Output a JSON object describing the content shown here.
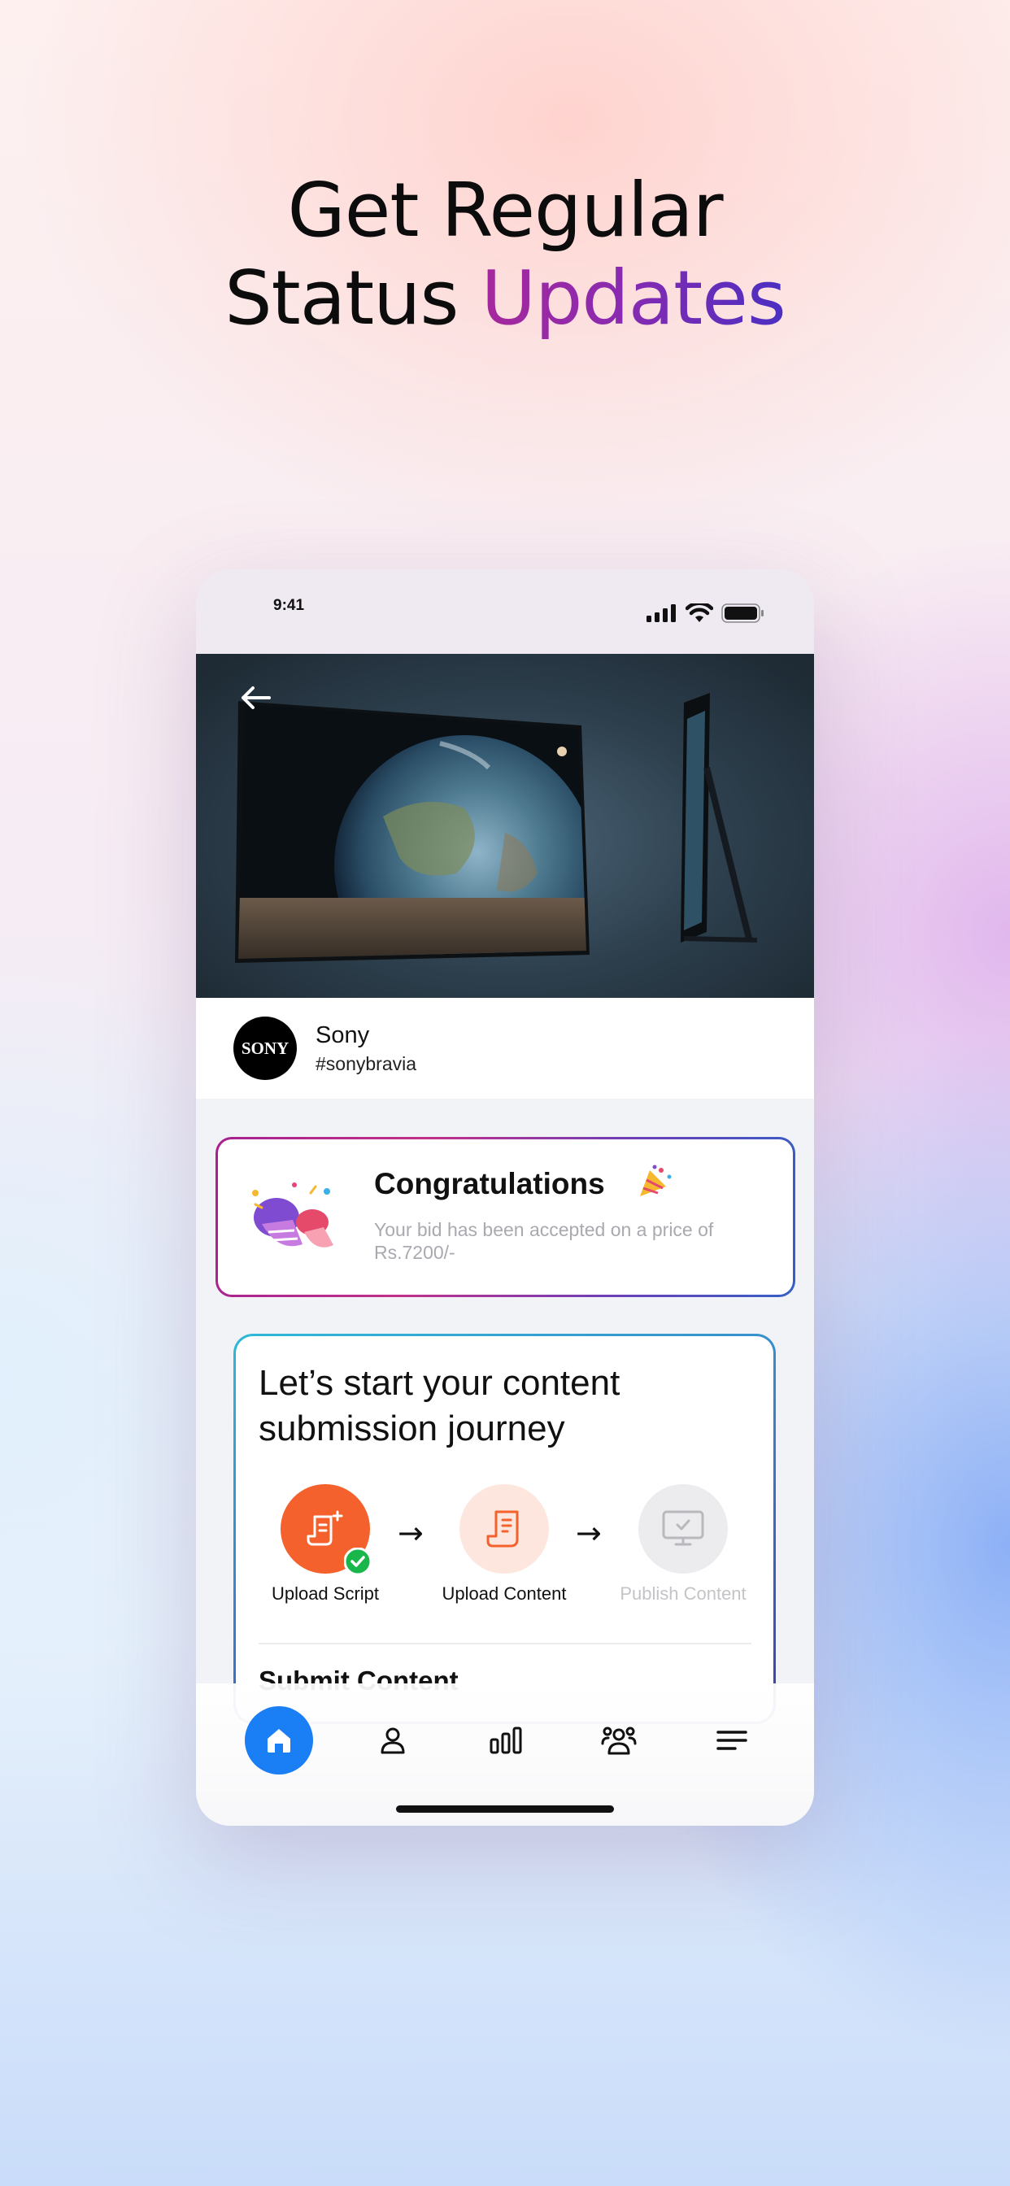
{
  "headline": {
    "line1": "Get Regular",
    "line2_plain": "Status",
    "line2_accent": "Updates"
  },
  "status_bar": {
    "time": "9:41"
  },
  "brand": {
    "logo_text": "SONY",
    "name": "Sony",
    "tag": "#sonybravia"
  },
  "congrats": {
    "title": "Congratulations",
    "message": "Your bid has been accepted on a price of Rs.7200/-"
  },
  "journey": {
    "title": "Let’s start your content submission journey",
    "steps": [
      {
        "label": "Upload Script",
        "state": "completed"
      },
      {
        "label": "Upload Content",
        "state": "current"
      },
      {
        "label": "Publish Content",
        "state": "disabled"
      }
    ],
    "arrow": "→",
    "next_section_title": "Submit Content"
  },
  "bottom_nav": {
    "items": [
      {
        "icon": "home-icon",
        "active": true
      },
      {
        "icon": "profile-icon",
        "active": false
      },
      {
        "icon": "stats-icon",
        "active": false
      },
      {
        "icon": "community-icon",
        "active": false
      },
      {
        "icon": "menu-icon",
        "active": false
      }
    ]
  },
  "colors": {
    "accent_blue": "#1a7ff5",
    "step_orange": "#f5612c",
    "step_orange_light": "#fde6de",
    "success_green": "#19b64b",
    "headline_accent": "#8a2ab0"
  }
}
